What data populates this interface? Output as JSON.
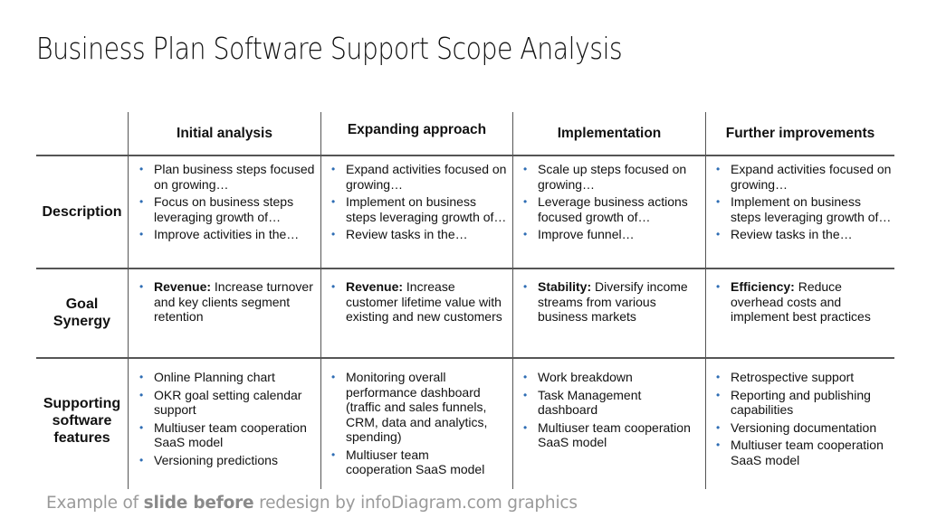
{
  "title": "Business Plan Software Support Scope Analysis",
  "columns": [
    "Initial analysis",
    "Expanding approach",
    "Implementation",
    "Further improvements"
  ],
  "rows": [
    {
      "label": "Description",
      "cells": [
        [
          {
            "text": "Plan business steps focused on growing…"
          },
          {
            "text": "Focus on business steps leveraging growth of…"
          },
          {
            "text": "Improve activities in the…"
          }
        ],
        [
          {
            "text": "Expand activities focused on growing…"
          },
          {
            "text": "Implement on business steps leveraging growth of…"
          },
          {
            "text": "Review tasks in the…"
          }
        ],
        [
          {
            "text": "Scale up steps focused on growing…"
          },
          {
            "text": "Leverage business actions focused growth of…"
          },
          {
            "text": "Improve funnel…"
          }
        ],
        [
          {
            "text": "Expand activities focused on growing…"
          },
          {
            "text": "Implement on business steps leveraging growth of…"
          },
          {
            "text": "Review tasks in the…"
          }
        ]
      ]
    },
    {
      "label": "Goal Synergy",
      "cells": [
        [
          {
            "bold": "Revenue:",
            "text": " Increase turnover and key clients segment retention"
          }
        ],
        [
          {
            "bold": "Revenue:",
            "text": " Increase customer lifetime value with existing and new customers"
          }
        ],
        [
          {
            "bold": "Stability:",
            "text": " Diversify income streams from various business markets"
          }
        ],
        [
          {
            "bold": "Efficiency:",
            "text": " Reduce overhead costs and implement best practices"
          }
        ]
      ]
    },
    {
      "label": "Supporting software features",
      "cells": [
        [
          {
            "text": "Online Planning chart"
          },
          {
            "text": "OKR goal setting calendar support"
          },
          {
            "text": "Multiuser team cooperation SaaS model"
          },
          {
            "text": "Versioning predictions"
          }
        ],
        [
          {
            "text": "Monitoring overall performance dashboard (traffic and sales funnels, CRM,  data and analytics, spending)"
          },
          {
            "text": "Multiuser team cooperation SaaS model"
          }
        ],
        [
          {
            "text": "Work breakdown"
          },
          {
            "text": "Task Management dashboard"
          },
          {
            "text": "Multiuser team cooperation SaaS model"
          }
        ],
        [
          {
            "text": "Retrospective support"
          },
          {
            "text": "Reporting and publishing capabilities"
          },
          {
            "text": "Versioning documentation"
          },
          {
            "text": "Multiuser team cooperation SaaS model"
          }
        ]
      ]
    }
  ],
  "footer": {
    "prefix": "Example of ",
    "bold": "slide before",
    "suffix": " redesign by infoDiagram.com graphics"
  },
  "colors": {
    "bullet": "#2e6db4",
    "grid_line": "#555555",
    "footer_text": "#9a9a9a"
  }
}
